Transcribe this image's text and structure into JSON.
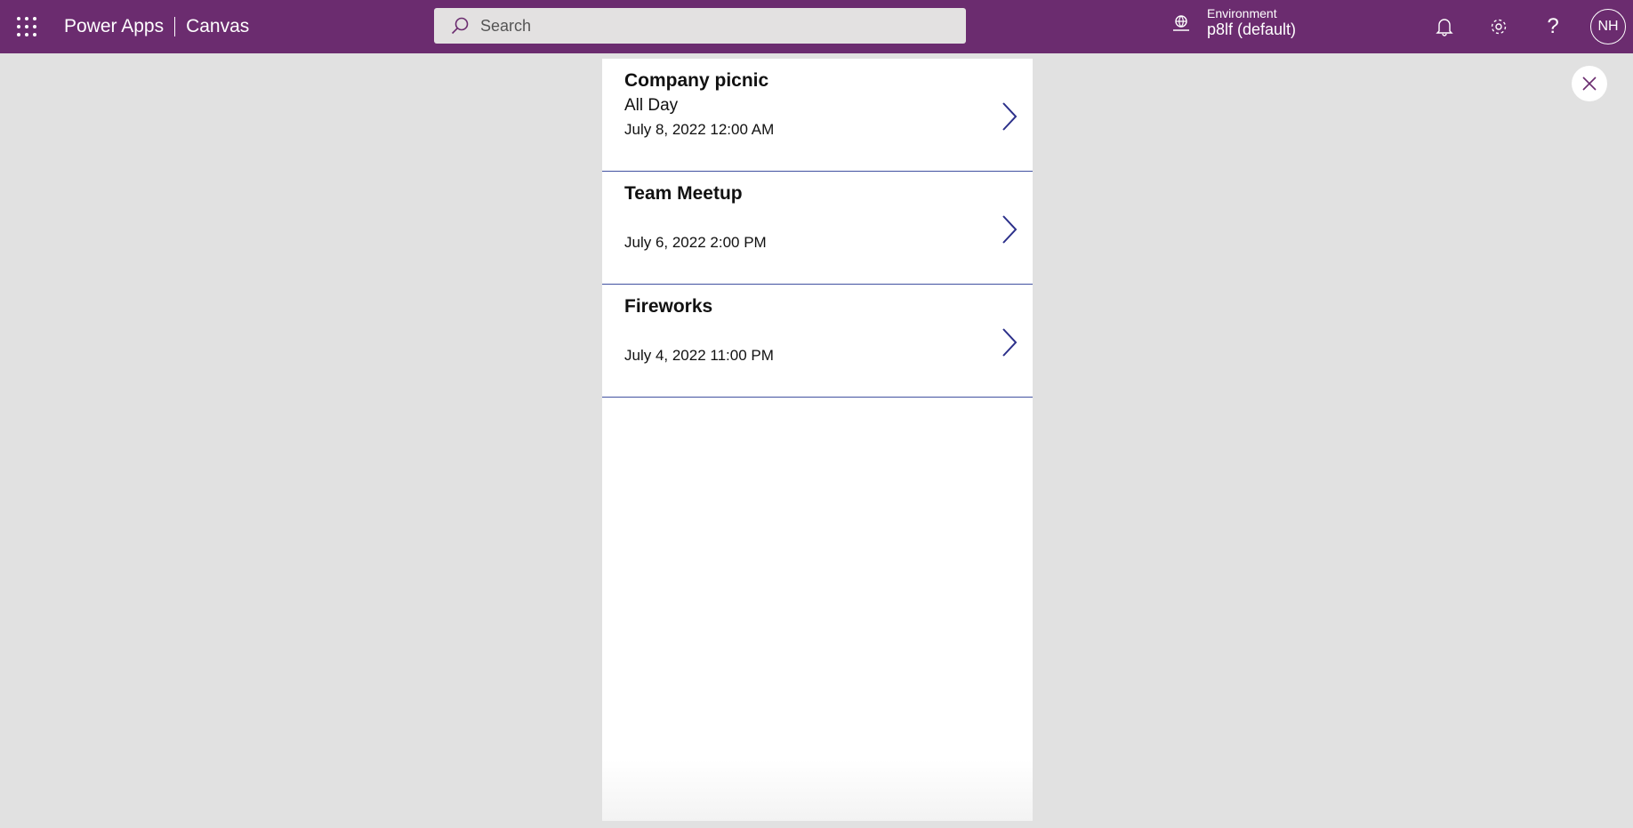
{
  "header": {
    "app_name": "Power Apps",
    "app_type": "Canvas",
    "search_placeholder": "Search",
    "environment_label": "Environment",
    "environment_value": "p8lf (default)",
    "avatar_initials": "NH"
  },
  "events": [
    {
      "title": "Company picnic",
      "subtitle": "All Day",
      "datetime": "July 8, 2022 12:00 AM"
    },
    {
      "title": "Team Meetup",
      "subtitle": "",
      "datetime": "July 6, 2022 2:00 PM"
    },
    {
      "title": "Fireworks",
      "subtitle": "",
      "datetime": "July 4, 2022 11:00 PM"
    }
  ],
  "colors": {
    "header": "#6b2c6f",
    "accent": "#2b2f8a",
    "background": "#e1e1e1"
  }
}
